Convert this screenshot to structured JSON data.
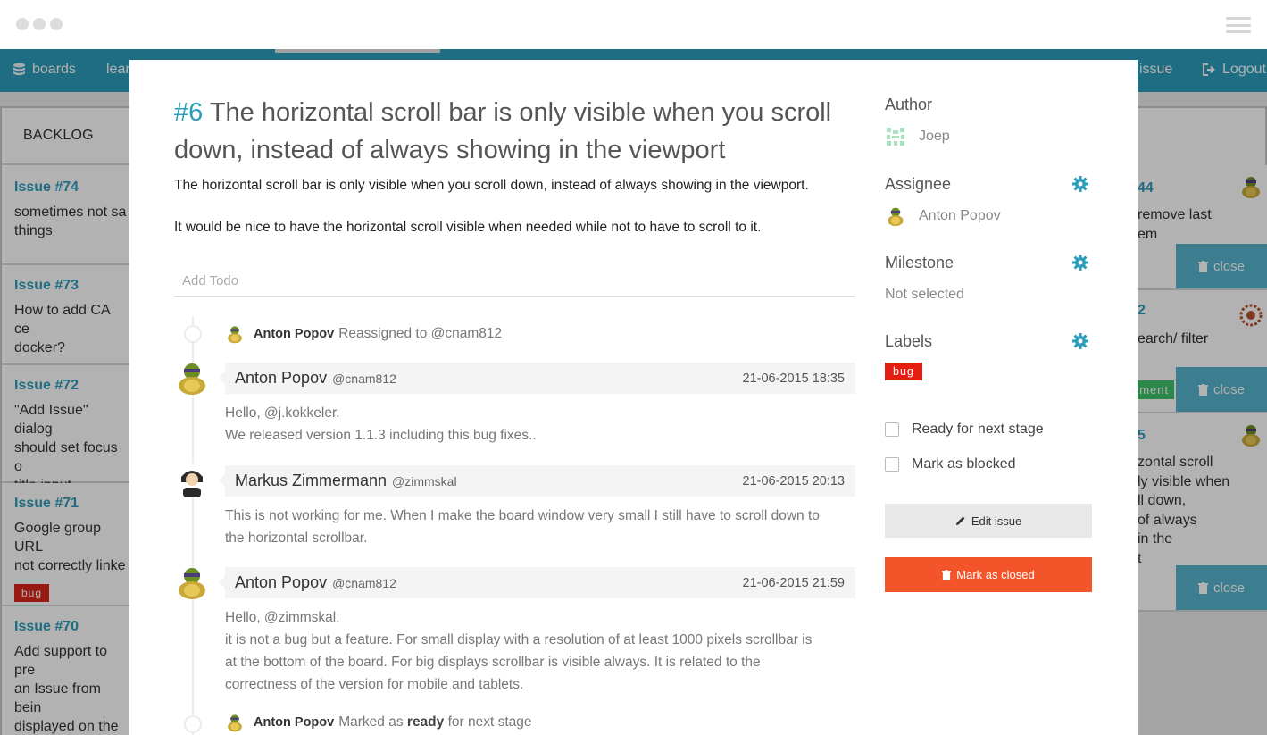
{
  "nav": {
    "boards_label": "boards",
    "second_label": "lear",
    "issue_label": "issue",
    "logout_label": "Logout"
  },
  "backlog": {
    "title": "BACKLOG",
    "cards": [
      {
        "title": "Issue #74",
        "body": "sometimes not sa\nthings"
      },
      {
        "title": "Issue #73",
        "body": "How to add CA ce\ndocker?"
      },
      {
        "title": "Issue #72",
        "body": "\"Add Issue\" dialog\nshould set focus o\ntitle input"
      },
      {
        "title": "Issue #71",
        "body": "Google group URL\nnot correctly linke",
        "label": "bug"
      },
      {
        "title": "Issue #70",
        "body": "Add support to pre\nan Issue from bein\ndisplayed on the\nkanban"
      }
    ]
  },
  "right_column": {
    "cards": [
      {
        "title": "44",
        "body": "remove last\nem",
        "close": "close"
      },
      {
        "title": "2",
        "body": "earch/ filter",
        "label": "ement",
        "close": "close"
      },
      {
        "title": "5",
        "body": "zontal scroll\nly visible when\nll down,\nof always\nin the\nt",
        "close": "close"
      }
    ]
  },
  "issue": {
    "number": "#6",
    "title": "The horizontal scroll bar is only visible when you scroll down, instead of always showing in the viewport",
    "description_1": "The horizontal scroll bar is only visible when you scroll down, instead of always showing in the viewport.",
    "description_2": "It would be nice to have the horizontal scroll visible when needed while not to have to scroll to it.",
    "todo_placeholder": "Add Todo"
  },
  "timeline": {
    "event1": {
      "user": "Anton Popov",
      "text": "Reassigned to @cnam812"
    },
    "comments": [
      {
        "name": "Anton Popov",
        "handle": "@cnam812",
        "date": "21-06-2015 18:35",
        "lines": [
          "Hello, @j.kokkeler.",
          "We released version 1.1.3 including this bug fixes.."
        ]
      },
      {
        "name": "Markus Zimmermann",
        "handle": "@zimmskal",
        "date": "21-06-2015 20:13",
        "lines": [
          "This is not working for me. When I make the board window very small I still have to scroll down to",
          "the horizontal scrollbar."
        ]
      },
      {
        "name": "Anton Popov",
        "handle": "@cnam812",
        "date": "21-06-2015 21:59",
        "lines": [
          "Hello, @zimmskal.",
          "it is not a bug but a feature. For small display with a resolution of at least 1000 pixels scrollbar is",
          "at the bottom of the board. For big displays scrollbar is visible always. It is related to the",
          "correctness of the version for mobile and tablets."
        ]
      }
    ],
    "event2": {
      "user": "Anton Popov",
      "text_before": "Marked as",
      "strong": "ready",
      "text_after": "for next stage"
    }
  },
  "sidebar": {
    "author_heading": "Author",
    "author_name": "Joep",
    "assignee_heading": "Assignee",
    "assignee_name": "Anton Popov",
    "milestone_heading": "Milestone",
    "milestone_value": "Not selected",
    "labels_heading": "Labels",
    "label_bug": "bug",
    "ready_label": "Ready for next stage",
    "blocked_label": "Mark as blocked",
    "edit_button": "Edit issue",
    "close_button": "Mark as closed"
  },
  "colors": {
    "accent": "#2b9dbb",
    "danger": "#f4542a",
    "bug_label": "#e61e12",
    "success": "#3ec26b"
  }
}
